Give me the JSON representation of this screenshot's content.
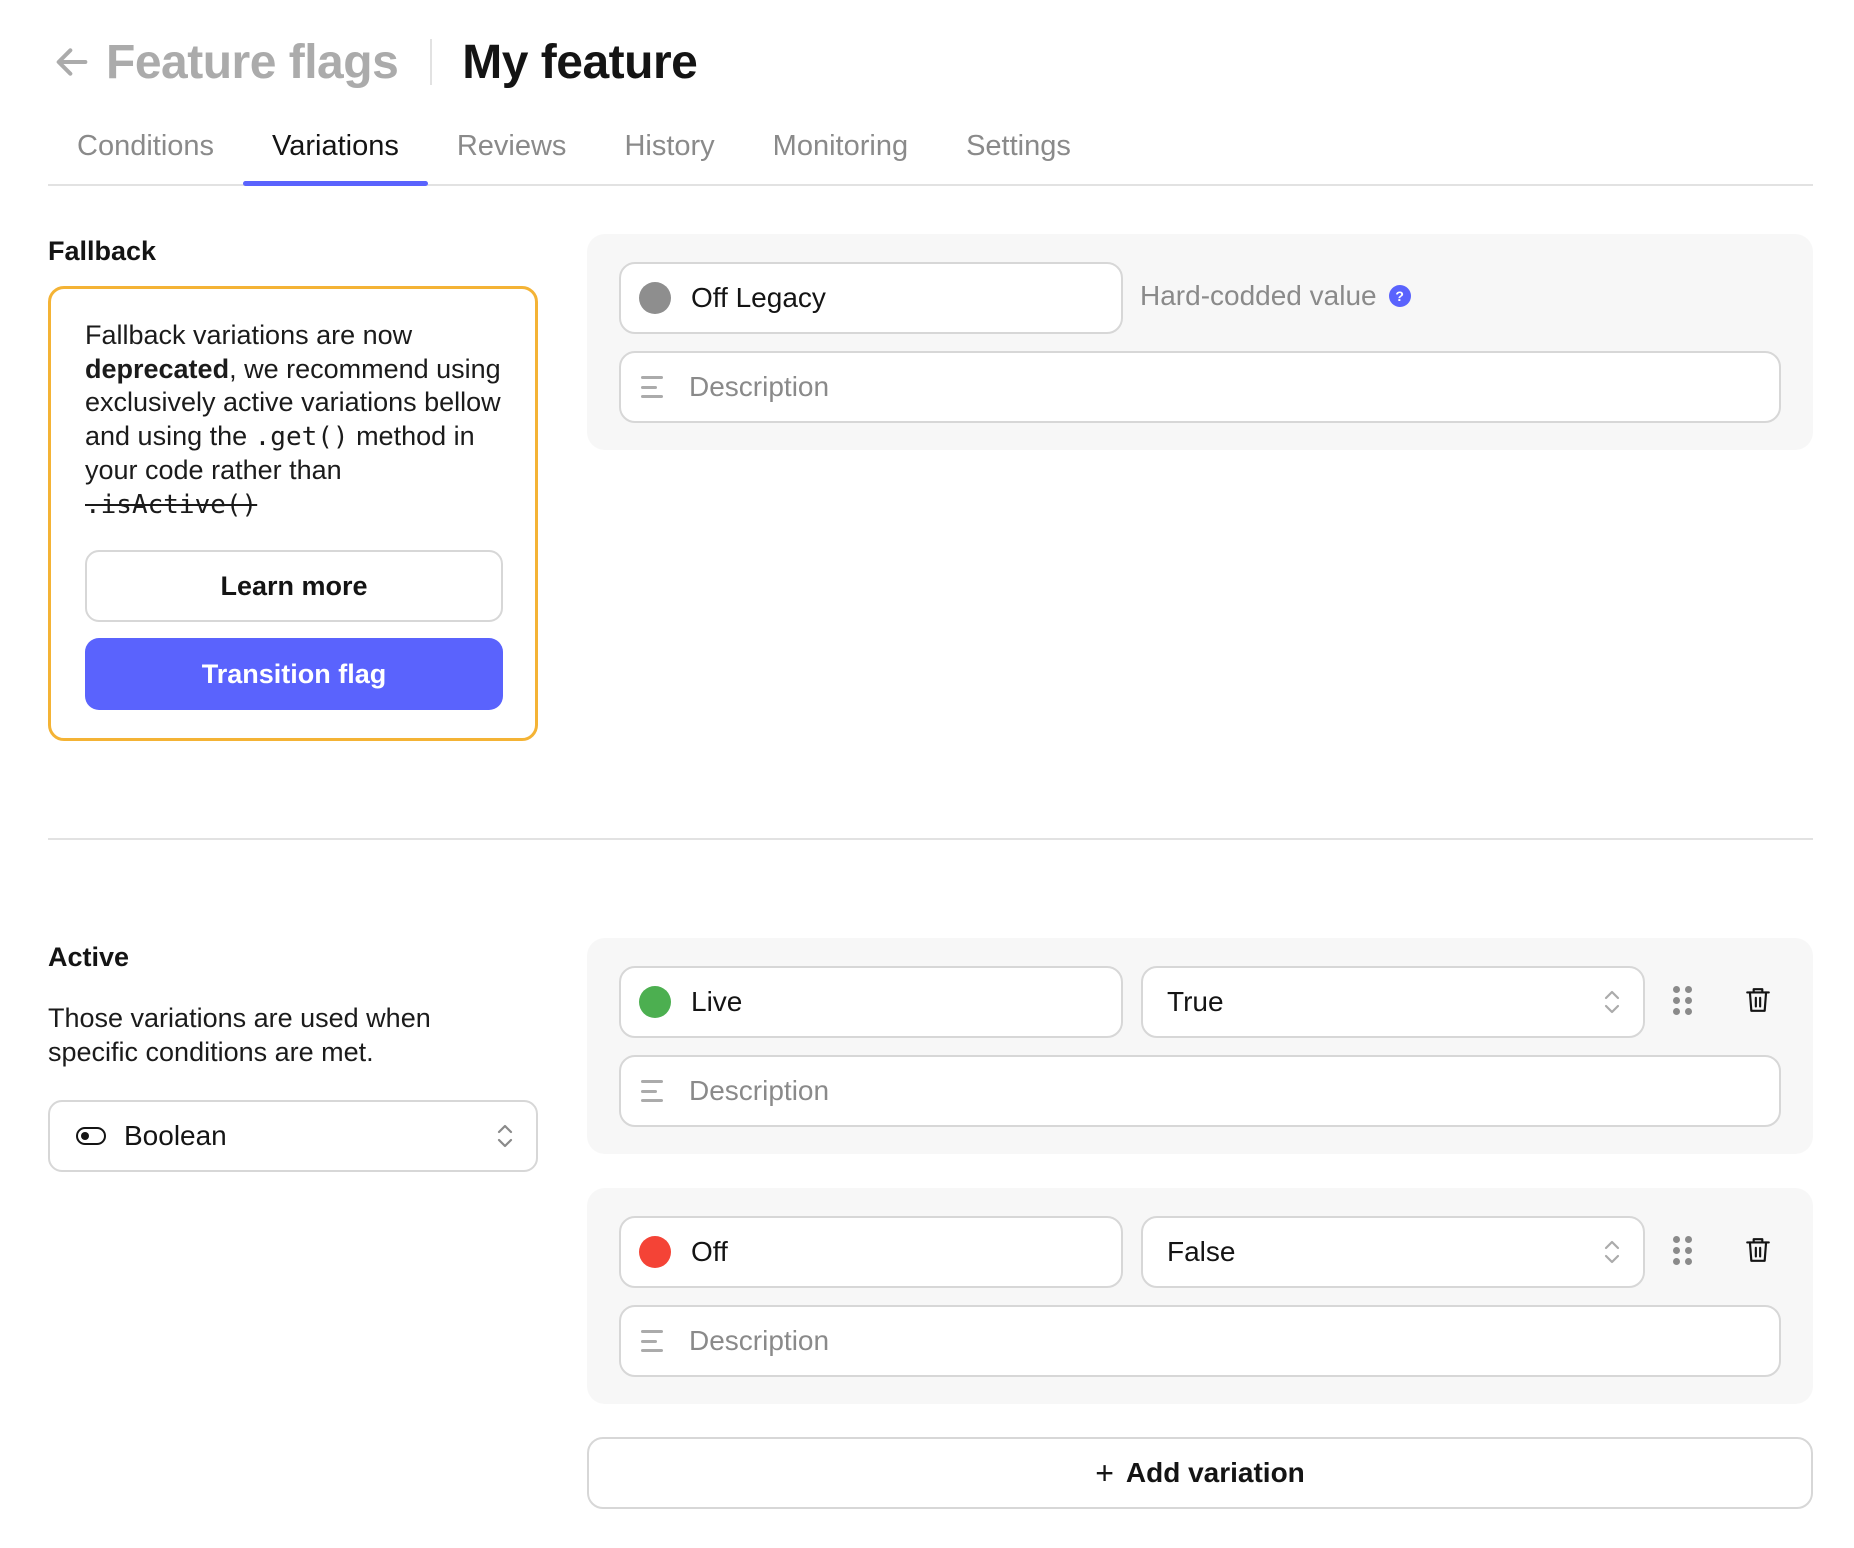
{
  "header": {
    "back_icon": "arrow-left-icon",
    "breadcrumb": "Feature flags",
    "title": "My feature"
  },
  "tabs": [
    {
      "label": "Conditions",
      "active": false
    },
    {
      "label": "Variations",
      "active": true
    },
    {
      "label": "Reviews",
      "active": false
    },
    {
      "label": "History",
      "active": false
    },
    {
      "label": "Monitoring",
      "active": false
    },
    {
      "label": "Settings",
      "active": false
    }
  ],
  "fallback": {
    "section_title": "Fallback",
    "warning": {
      "text_1": "Fallback variations are now ",
      "text_bold": "deprecated",
      "text_2": ", we recommend using exclusively active variations bellow and using the ",
      "code_get": ".get()",
      "text_3": " method in your code rather than ",
      "code_isactive": ".isActive()"
    },
    "learn_more_label": "Learn more",
    "transition_label": "Transition flag",
    "variation": {
      "name": "Off Legacy",
      "color": "#8e8e8e",
      "hint": "Hard-codded value",
      "help_icon": "?",
      "description_placeholder": "Description"
    }
  },
  "active": {
    "section_title": "Active",
    "description": "Those variations are used when specific conditions are met.",
    "type_select": {
      "value": "Boolean",
      "icon": "toggle-icon"
    },
    "variations": [
      {
        "name": "Live",
        "color": "#4caf50",
        "value": "True",
        "description_placeholder": "Description"
      },
      {
        "name": "Off",
        "color": "#f44336",
        "value": "False",
        "description_placeholder": "Description"
      }
    ],
    "add_variation_label": "Add variation",
    "add_icon": "+"
  },
  "colors": {
    "accent": "#5a63fd",
    "warning_border": "#f4b335"
  }
}
